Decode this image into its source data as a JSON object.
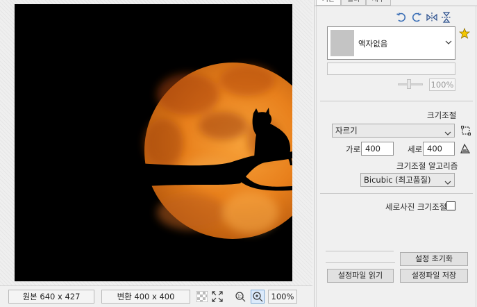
{
  "tabs": [
    "기본",
    "필터",
    "세부"
  ],
  "frame": {
    "selected": "액자없음"
  },
  "preview": {
    "zoom": "100%"
  },
  "resize": {
    "section_title": "크기조절",
    "mode": "자르기",
    "width_label": "가로",
    "width": "400",
    "height_label": "세로",
    "height": "400",
    "algorithm_title": "크기조절 알고리즘",
    "algorithm": "Bicubic (최고품질)",
    "portrait_label": "세로사진 크기조절"
  },
  "buttons": {
    "reset": "설정 초기화",
    "load": "설정파일 읽기",
    "save": "설정파일 저장"
  },
  "status": {
    "original": "원본 640 x 427",
    "converted": "변환 400 x 400",
    "zoom": "100%"
  },
  "colors": {
    "moon": "#f08a1e",
    "moon_dark": "#b24a08",
    "accent_star": "#f5c800",
    "icon_blue": "#3b6fb6"
  },
  "icons": [
    "rotate-left-icon",
    "rotate-right-icon",
    "flip-horizontal-icon",
    "flip-vertical-icon",
    "favorite-star-icon",
    "crop-frame-icon",
    "sharpen-icon",
    "transparency-grid-icon",
    "fit-screen-icon",
    "zoom-actual-icon",
    "zoom-fit-icon"
  ]
}
